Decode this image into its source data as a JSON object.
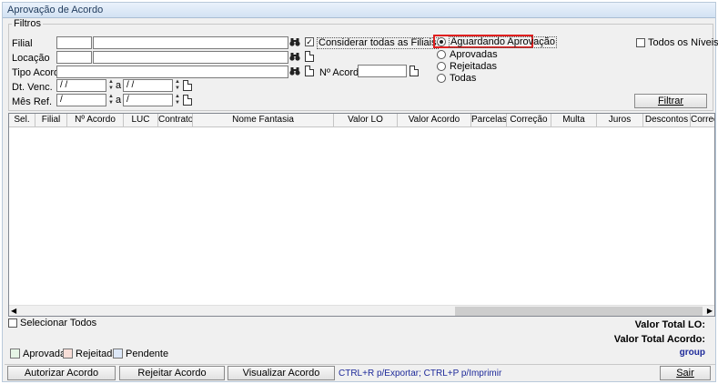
{
  "window": {
    "title": "Aprovação de Acordo"
  },
  "filters": {
    "legend": "Filtros",
    "filial_label": "Filial",
    "locacao_label": "Locação",
    "tipo_acordo_label": "Tipo Acordo",
    "dt_venc_label": "Dt. Venc.",
    "mes_ref_label": "Mês Ref.",
    "considerar_label": "Considerar todas as Filiais",
    "considerar_checked": true,
    "n_acordo_label": "Nº Acordo",
    "dt_venc_from": " / /",
    "dt_venc_to": " / /",
    "mes_ref_from": "/",
    "mes_ref_to": "/",
    "range_sep": "a",
    "status_options": [
      "Aguardando Aprovação",
      "Aprovadas",
      "Rejeitadas",
      "Todas"
    ],
    "status_selected": "Aguardando Aprovação",
    "todos_niveis_label": "Todos os Níveis",
    "filtrar_label": "Filtrar"
  },
  "grid": {
    "columns": [
      "Sel.",
      "Filial",
      "Nº Acordo",
      "LUC",
      "Contrato",
      "Nome Fantasia",
      "Valor LO",
      "Valor Acordo",
      "Parcelas",
      "Correção",
      "Multa",
      "Juros",
      "Descontos",
      "Correção"
    ],
    "rows": []
  },
  "selecionar_todos_label": "Selecionar Todos",
  "totals": {
    "valor_total_lo_label": "Valor Total LO:",
    "valor_total_acordo_label": "Valor Total Acordo:",
    "group_label": "group"
  },
  "legend": {
    "items": [
      {
        "label": "Aprovada",
        "color": "#e6f5e6"
      },
      {
        "label": "Rejeitada",
        "color": "#f8ded8"
      },
      {
        "label": "Pendente",
        "color": "#dde8f8"
      }
    ]
  },
  "footer": {
    "autorizar_label": "Autorizar Acordo",
    "rejeitar_label": "Rejeitar Acordo",
    "visualizar_label": "Visualizar Acordo",
    "shortcuts_text": "CTRL+R p/Exportar; CTRL+P p/Imprimir",
    "sair_label": "Sair"
  },
  "colors": {
    "highlight_border": "#e02020",
    "accent_text": "#1e2a9a"
  }
}
